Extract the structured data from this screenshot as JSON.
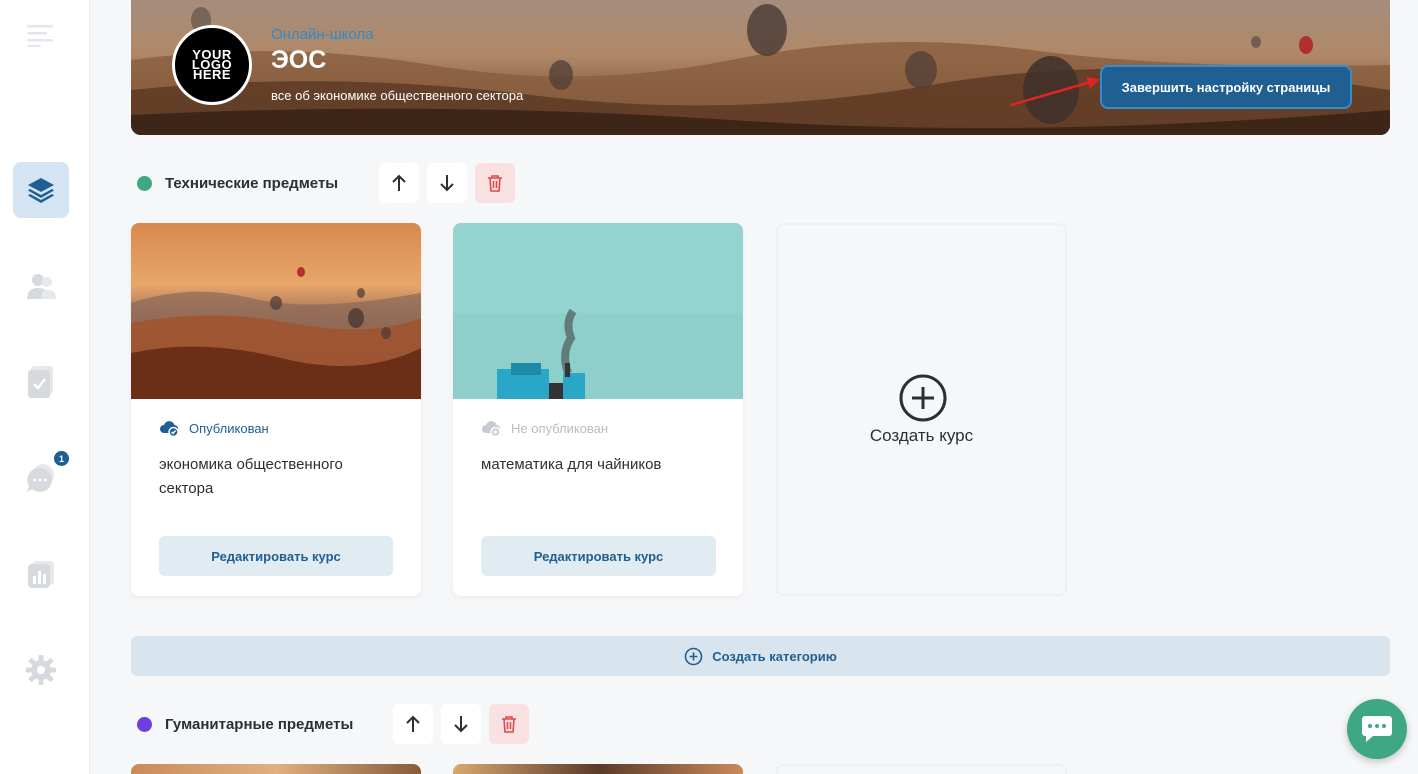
{
  "sidebar": {
    "items": [
      {
        "name": "menu-icon"
      },
      {
        "name": "layers-icon",
        "active": true
      },
      {
        "name": "users-icon"
      },
      {
        "name": "tasks-icon"
      },
      {
        "name": "chat-icon",
        "badge": "1"
      },
      {
        "name": "stats-icon"
      },
      {
        "name": "settings-icon"
      }
    ]
  },
  "banner": {
    "logo_text": "YOUR\nLOGO\nHERE",
    "school_type": "Онлайн-школа",
    "school_name": "ЭОС",
    "description": "все об экономике общественного сектора",
    "finish_button": "Завершить настройку страницы"
  },
  "categories": [
    {
      "title": "Технические предметы",
      "color": "#3fa783",
      "courses": [
        {
          "status": "Опубликован",
          "title": "экономика общественного сектора",
          "edit_label": "Редактировать курс"
        },
        {
          "status": "Не опубликован",
          "title": "математика для чайников",
          "edit_label": "Редактировать курс"
        }
      ],
      "create_course_label": "Создать курс"
    },
    {
      "title": "Гуманитарные предметы",
      "color": "#6d3fe0"
    }
  ],
  "create_category_label": "Создать категорию",
  "colors": {
    "accent": "#1f5f91",
    "accent_light": "#e1ebf2",
    "delete_bg": "#f9e1e1",
    "chat_fab": "#3fa783"
  }
}
